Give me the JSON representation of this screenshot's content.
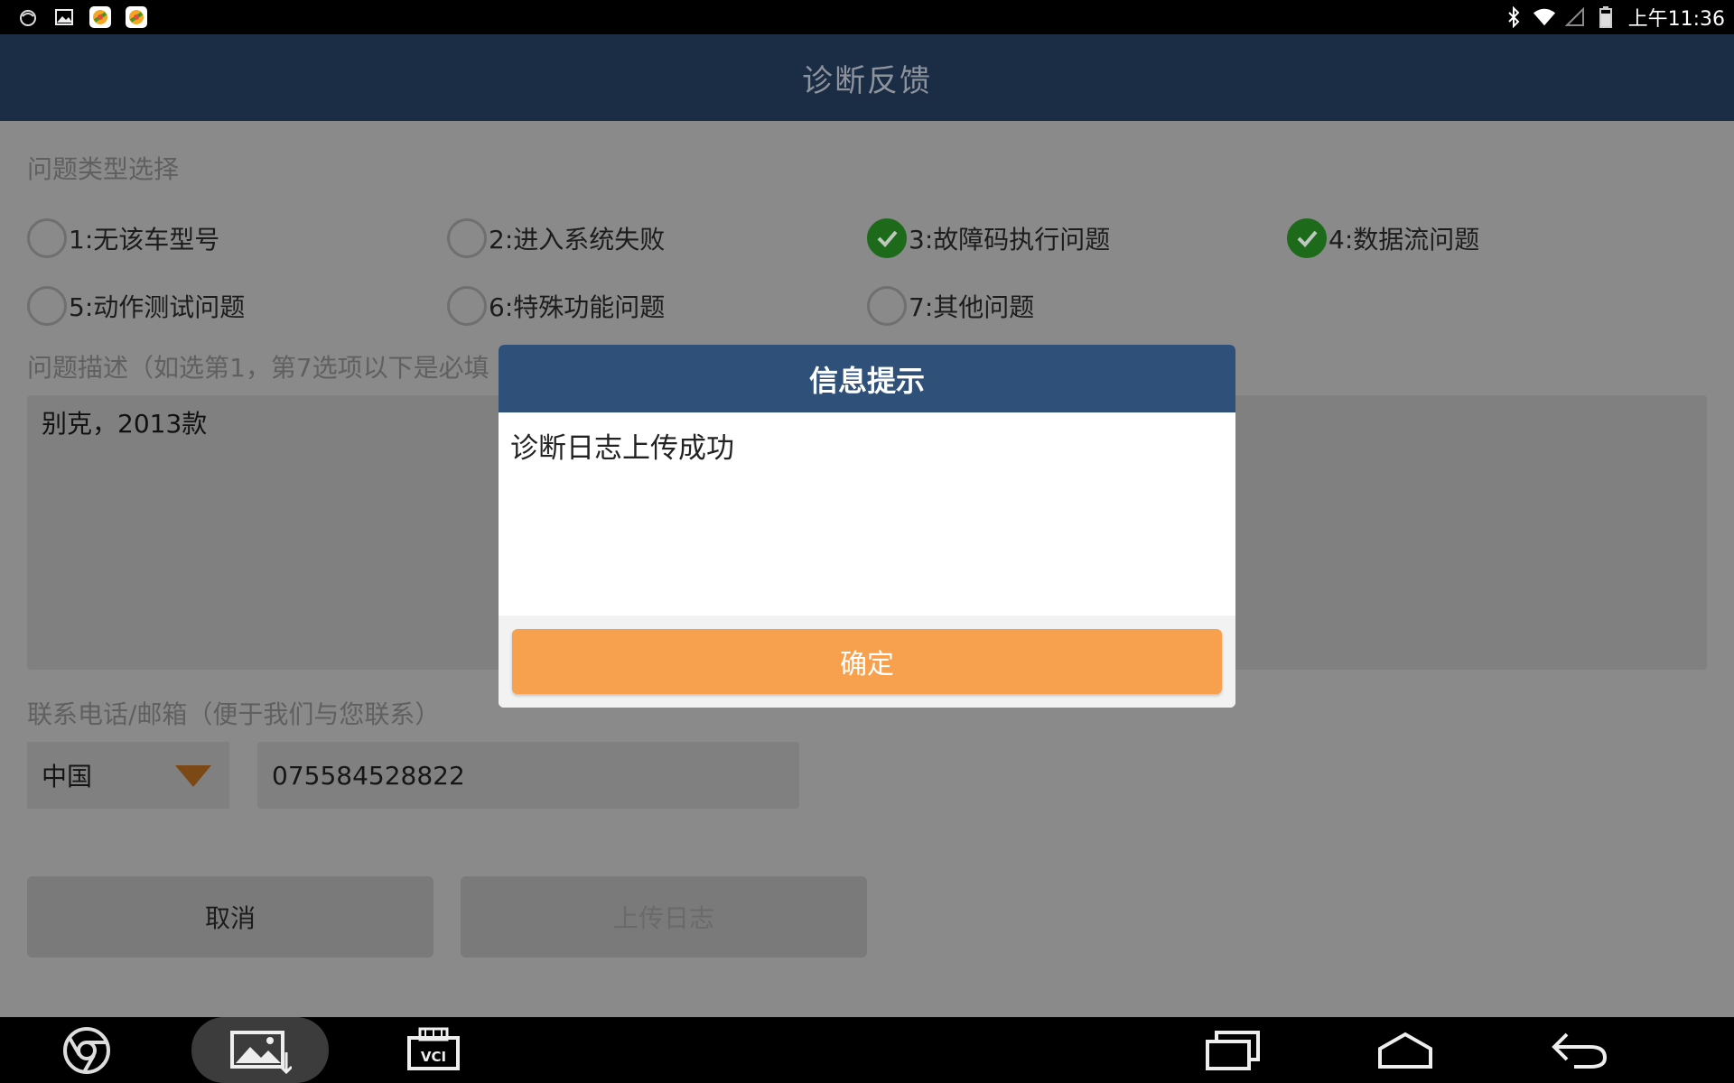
{
  "status_bar": {
    "time": "上午11:36",
    "left_icons": [
      "notification-icon",
      "gallery-icon",
      "app-icon",
      "app-icon"
    ],
    "right_icons": [
      "bluetooth-icon",
      "wifi-icon",
      "signal-icon",
      "battery-icon"
    ]
  },
  "header": {
    "title": "诊断反馈"
  },
  "form": {
    "problem_type_label": "问题类型选择",
    "options": [
      {
        "label": "1:无该车型号",
        "checked": false
      },
      {
        "label": "2:进入系统失败",
        "checked": false
      },
      {
        "label": "3:故障码执行问题",
        "checked": true
      },
      {
        "label": "4:数据流问题",
        "checked": true
      },
      {
        "label": "5:动作测试问题",
        "checked": false
      },
      {
        "label": "6:特殊功能问题",
        "checked": false
      },
      {
        "label": "7:其他问题",
        "checked": false
      }
    ],
    "description_label": "问题描述（如选第1，第7选项以下是必填",
    "description_value": "别克，2013款",
    "contact_label": "联系电话/邮箱（便于我们与您联系）",
    "country_value": "中国",
    "phone_value": "075584528822",
    "cancel_label": "取消",
    "upload_label": "上传日志"
  },
  "dialog": {
    "title": "信息提示",
    "message": "诊断日志上传成功",
    "confirm_label": "确定"
  },
  "nav_bar": {
    "left_icons": [
      "chrome-icon",
      "gallery-screenshot-icon",
      "vci-icon"
    ],
    "vci_text": "VCI",
    "right_icons": [
      "recent-apps-icon",
      "home-icon",
      "back-icon"
    ]
  },
  "colors": {
    "header_bg": "#1b2c45",
    "dialog_header_bg": "#2f5078",
    "confirm_button": "#f7a04d",
    "checked_radio": "#1c6a1a",
    "dim_background": "#8a8a8a"
  }
}
